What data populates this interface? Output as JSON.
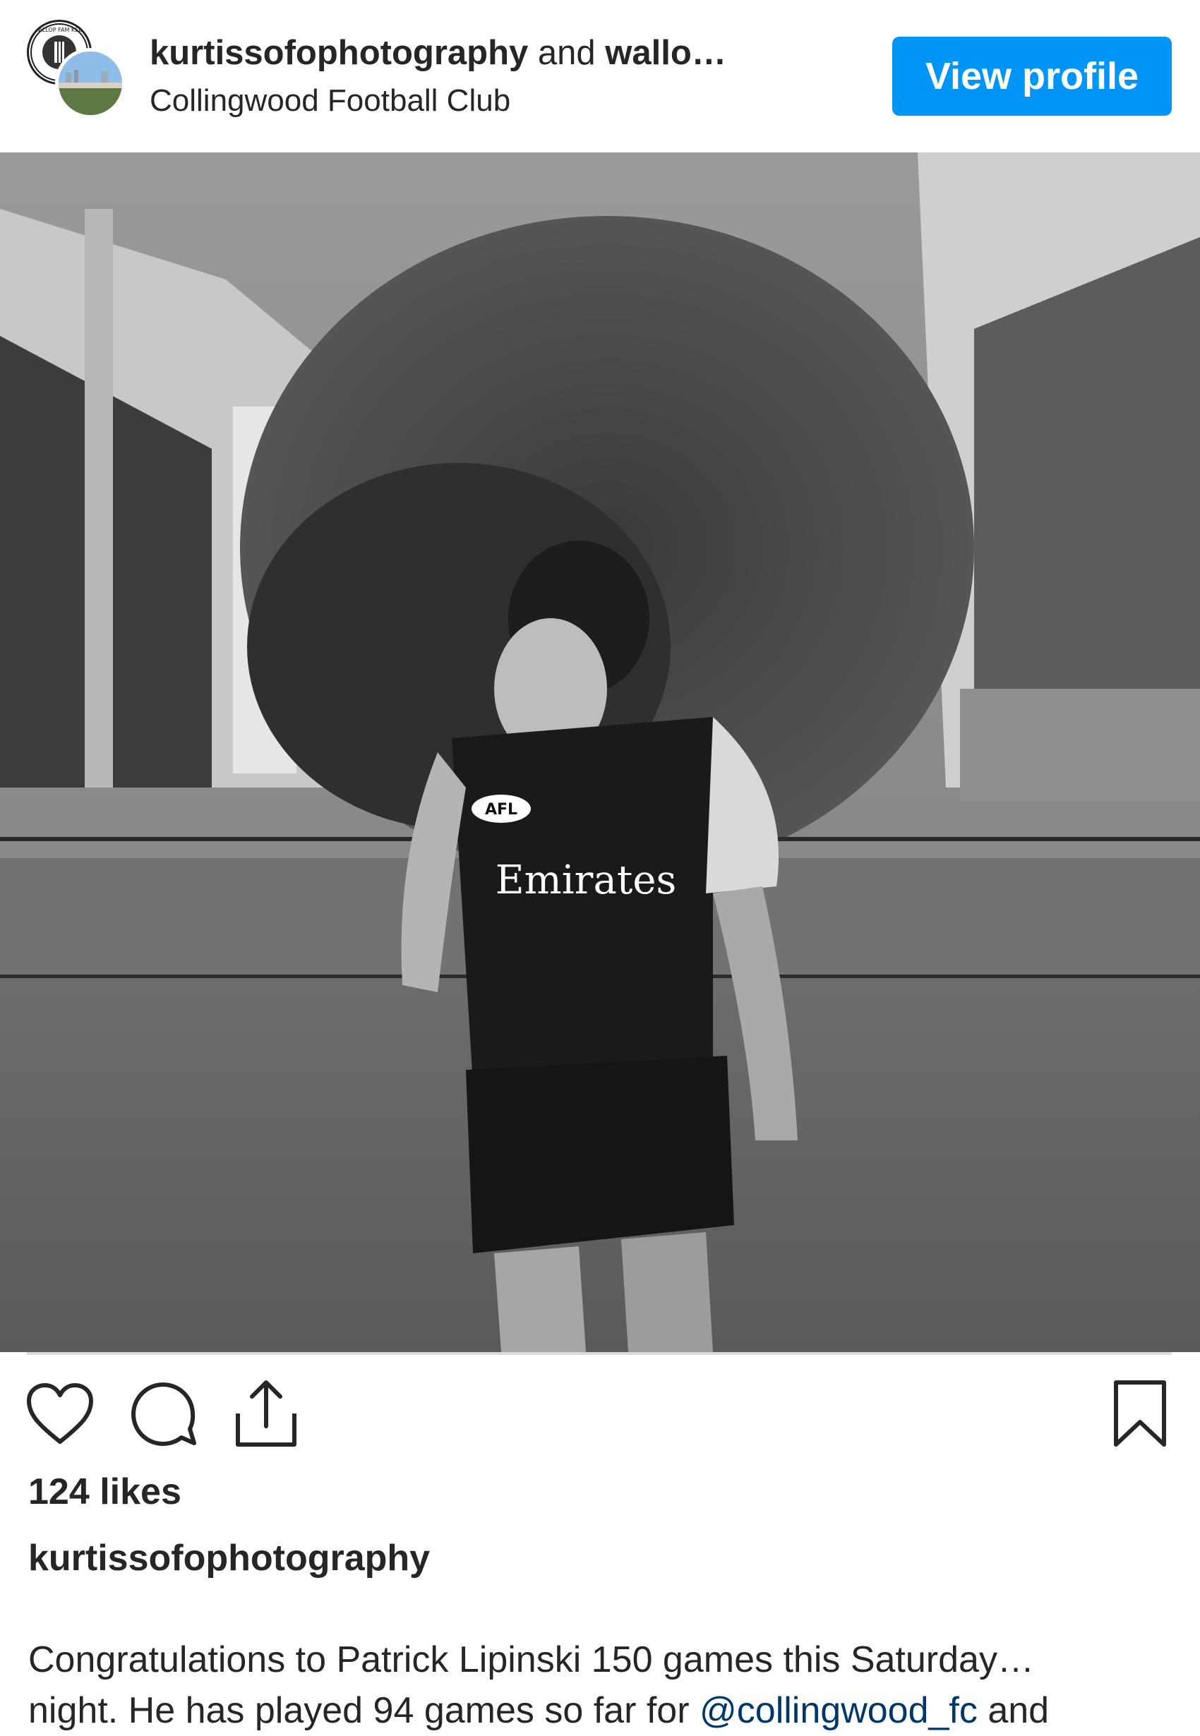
{
  "header": {
    "primary_user": "kurtissofophotography",
    "joiner": "and",
    "secondary_user": "wallo…",
    "location": "Collingwood Football Club",
    "view_profile_label": "View profile",
    "avatar_text": "WALLOP FAM KEEP",
    "brand_color": "#0095f6"
  },
  "post": {
    "image_icon": "photo",
    "jersey_sponsor": "Emirates",
    "jersey_badge": "AFL"
  },
  "actions": {
    "like_icon": "heart-icon",
    "comment_icon": "comment-icon",
    "share_icon": "share-icon",
    "save_icon": "bookmark-icon"
  },
  "likes": "124 likes",
  "caption": {
    "username": "kurtissofophotography",
    "line1": "Congratulations to Patrick Lipinski 150 games this Saturday…",
    "line2_prefix": "night. He has played 94 games so far for ",
    "mention": "@collingwood_fc",
    "line2_suffix": " and"
  }
}
